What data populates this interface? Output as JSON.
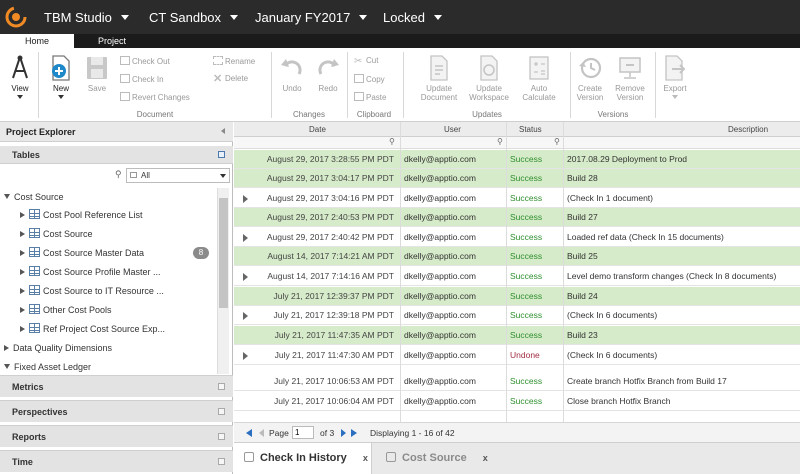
{
  "colors": {
    "topbar": "#2b2b2b",
    "success": "#2f8f2f",
    "undone": "#a12e43",
    "row_highlight": "#d6ebc9"
  },
  "topbar": {
    "logo": "apptio-logo-icon",
    "menus": [
      {
        "label": "TBM Studio"
      },
      {
        "label": "CT Sandbox"
      },
      {
        "label": "January FY2017"
      },
      {
        "label": "Locked"
      }
    ]
  },
  "ribbon_tabs": [
    {
      "label": "Home"
    },
    {
      "label": "Project"
    }
  ],
  "ribbon": {
    "view": "View",
    "new": "New",
    "save": "Save",
    "check_out": "Check Out",
    "check_in": "Check In",
    "revert": "Revert Changes",
    "rename": "Rename",
    "delete": "Delete",
    "undo": "Undo",
    "redo": "Redo",
    "cut": "Cut",
    "copy": "Copy",
    "paste": "Paste",
    "update_document": [
      "Update",
      "Document"
    ],
    "update_workspace": [
      "Update",
      "Workspace"
    ],
    "auto_calculate": [
      "Auto",
      "Calculate"
    ],
    "create_version": [
      "Create",
      "Version"
    ],
    "remove_version": [
      "Remove",
      "Version"
    ],
    "export": "Export",
    "groups": {
      "document": "Document",
      "changes": "Changes",
      "clipboard": "Clipboard",
      "updates": "Updates",
      "versions": "Versions"
    }
  },
  "left_panel": {
    "title": "Project Explorer",
    "tables_label": "Tables",
    "filter_value": "All",
    "tree": [
      {
        "label": "Cost Source"
      },
      {
        "label": "Cost Pool Reference List"
      },
      {
        "label": "Cost Source"
      },
      {
        "label": "Cost Source Master Data",
        "badge": "8"
      },
      {
        "label": "Cost Source Profile Master ..."
      },
      {
        "label": "Cost Source to IT Resource ..."
      },
      {
        "label": "Other Cost Pools"
      },
      {
        "label": "Ref Project Cost Source Exp..."
      },
      {
        "label": "Data Quality Dimensions"
      },
      {
        "label": "Fixed Asset Ledger"
      }
    ],
    "sections": [
      {
        "label": "Metrics"
      },
      {
        "label": "Perspectives"
      },
      {
        "label": "Reports"
      },
      {
        "label": "Time"
      }
    ]
  },
  "grid": {
    "columns": [
      {
        "label": "Date"
      },
      {
        "label": "User"
      },
      {
        "label": "Status"
      },
      {
        "label": "Description"
      }
    ],
    "rows": [
      {
        "date": "August 29, 2017 3:28:55 PM PDT",
        "user": "dkelly@apptio.com",
        "status": "Success",
        "description": "2017.08.29 Deployment to Prod"
      },
      {
        "date": "August 29, 2017 3:04:17 PM PDT",
        "user": "dkelly@apptio.com",
        "status": "Success",
        "description": "Build 28"
      },
      {
        "date": "August 29, 2017 3:04:16 PM PDT",
        "user": "dkelly@apptio.com",
        "status": "Success",
        "description": "(Check In 1 document)"
      },
      {
        "date": "August 29, 2017 2:40:53 PM PDT",
        "user": "dkelly@apptio.com",
        "status": "Success",
        "description": "Build 27"
      },
      {
        "date": "August 29, 2017 2:40:42 PM PDT",
        "user": "dkelly@apptio.com",
        "status": "Success",
        "description": "Loaded ref data (Check In 15 documents)"
      },
      {
        "date": "August 14, 2017 7:14:21 AM PDT",
        "user": "dkelly@apptio.com",
        "status": "Success",
        "description": "Build 25"
      },
      {
        "date": "August 14, 2017 7:14:16 AM PDT",
        "user": "dkelly@apptio.com",
        "status": "Success",
        "description": "Level demo transform changes (Check In 8 documents)"
      },
      {
        "date": "July 21, 2017 12:39:37 PM PDT",
        "user": "dkelly@apptio.com",
        "status": "Success",
        "description": "Build 24"
      },
      {
        "date": "July 21, 2017 12:39:18 PM PDT",
        "user": "dkelly@apptio.com",
        "status": "Success",
        "description": "(Check In 6 documents)"
      },
      {
        "date": "July 21, 2017 11:47:35 AM PDT",
        "user": "dkelly@apptio.com",
        "status": "Success",
        "description": "Build 23"
      },
      {
        "date": "July 21, 2017 11:47:30 AM PDT",
        "user": "dkelly@apptio.com",
        "status": "Undone",
        "description": "(Check In 6 documents)"
      },
      {
        "date": "July 21, 2017 10:06:53 AM PDT",
        "user": "dkelly@apptio.com",
        "status": "Success",
        "description": "Create branch Hotfix Branch from Build 17"
      },
      {
        "date": "July 21, 2017 10:06:04 AM PDT",
        "user": "dkelly@apptio.com",
        "status": "Success",
        "description": "Close branch Hotfix Branch"
      }
    ]
  },
  "pager": {
    "page_label": "Page",
    "page_value": "1",
    "of_label": "of 3",
    "displaying": "Displaying 1 - 16 of 42"
  },
  "bottom_tabs": [
    {
      "label": "Check In History",
      "close": "x"
    },
    {
      "label": "Cost Source",
      "close": "x"
    }
  ]
}
